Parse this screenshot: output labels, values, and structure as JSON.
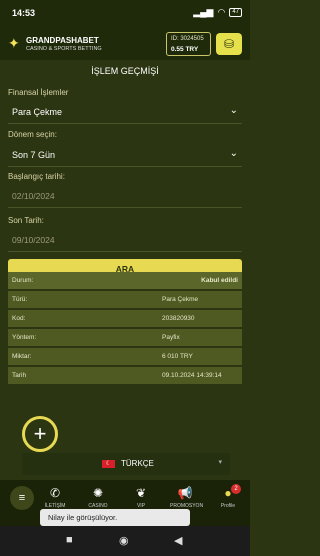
{
  "status": {
    "time": "14:53",
    "battery": "47"
  },
  "header": {
    "brand": "GRANDPASHABET",
    "tagline": "CASINO & SPORTS BETTING",
    "account_id": "ID: 3024505",
    "balance": "0.55 TRY"
  },
  "page": {
    "title": "İŞLEM GEÇMİŞİ"
  },
  "filters": {
    "finance_label": "Finansal İşlemler",
    "finance_value": "Para Çekme",
    "period_label": "Dönem seçin:",
    "period_value": "Son 7 Gün",
    "start_label": "Başlangıç tarihi:",
    "start_value": "02/10/2024",
    "end_label": "Son Tarih:",
    "end_value": "09/10/2024",
    "search_button": "ARA"
  },
  "details": [
    {
      "key": "Durum:",
      "value": "Kabul edildi"
    },
    {
      "key": "Türü:",
      "value": "Para Çekme"
    },
    {
      "key": "Kod:",
      "value": "203820930"
    },
    {
      "key": "Yöntem:",
      "value": "Payfix"
    },
    {
      "key": "Miktar:",
      "value": "6 010 TRY"
    },
    {
      "key": "Tarih",
      "value": "09.10.2024 14:39:14"
    }
  ],
  "language": {
    "label": "TÜRKÇE"
  },
  "bottom_nav": {
    "items": [
      {
        "label": "İLETİŞİM",
        "icon": "phone-icon"
      },
      {
        "label": "CASINO",
        "icon": "casino-chip-icon"
      },
      {
        "label": "VIP",
        "icon": "laurel-icon"
      },
      {
        "label": "PROMOSYON",
        "icon": "megaphone-icon"
      },
      {
        "label": "Profile",
        "icon": "user-icon"
      }
    ],
    "profile_badge": "2"
  },
  "chat": {
    "text": "Nilay ile görüşülüyor."
  },
  "colors": {
    "accent": "#e7da52",
    "background": "#2c3512",
    "row": "#4e5a22"
  }
}
